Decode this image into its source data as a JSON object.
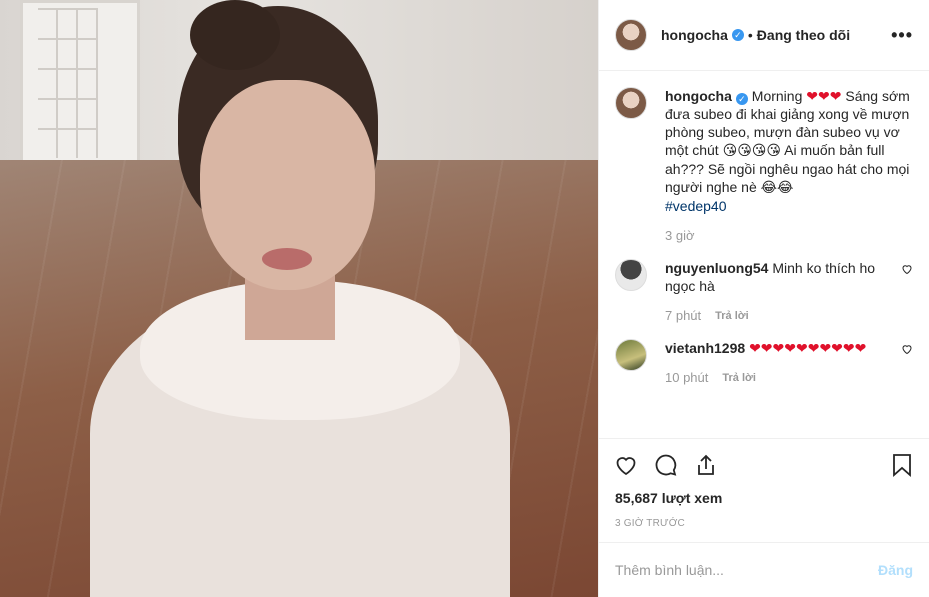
{
  "header": {
    "username": "hongocha",
    "verified_icon": "verified-badge-icon",
    "separator": "•",
    "follow_status": "Đang theo dõi",
    "more_label": "•••"
  },
  "caption": {
    "username": "hongocha",
    "text_a": "Morning",
    "hearts_a": "❤❤❤",
    "text_b": "Sáng sớm đưa subeo đi khai giảng xong về mượn phòng subeo, mượn đàn subeo vụ vơ một chút",
    "emojis_b": "😘😘😘😘",
    "text_c": "Ai muốn bản full ah??? Sẽ ngồi nghêu ngao hát cho mọi người nghe nè",
    "emojis_c": "😂😂",
    "hashtag": "#vedep40",
    "time": "3 giờ"
  },
  "comments": [
    {
      "username": "nguyenluong54",
      "text": "Minh ko thích ho ngọc hà",
      "time": "7 phút",
      "reply": "Trả lời"
    },
    {
      "username": "vietanh1298",
      "text": "❤❤❤❤❤❤❤❤❤❤",
      "time": "10 phút",
      "reply": "Trả lời"
    }
  ],
  "stats": {
    "views": "85,687 lượt xem",
    "posted": "3 GIỜ TRƯỚC"
  },
  "comment_box": {
    "placeholder": "Thêm bình luận...",
    "post_label": "Đăng"
  },
  "colors": {
    "verified": "#3897f0",
    "hashtag": "#003569",
    "heart": "#e0112b",
    "post_disabled": "#b2dffc"
  }
}
